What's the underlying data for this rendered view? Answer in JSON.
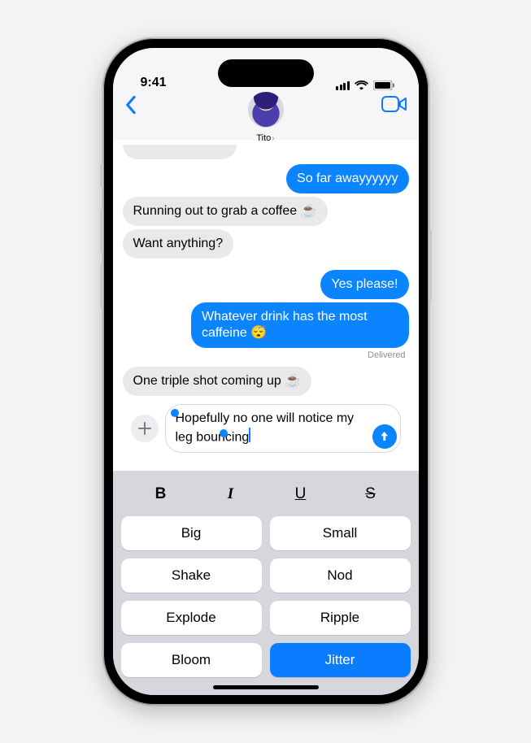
{
  "status": {
    "time": "9:41"
  },
  "header": {
    "contact_name": "Tito"
  },
  "conversation": {
    "m0": "So far awayyyyyy",
    "m1": "Running out to grab a coffee ☕️",
    "m2": "Want anything?",
    "m3": "Yes please!",
    "m4": "Whatever drink has the most caffeine 😴",
    "delivered": "Delivered",
    "m5": "One triple shot coming up ☕️"
  },
  "compose": {
    "text_full": "Hopefully no one will notice my leg bouncing",
    "text_before_caret": "Hopefully no one will notice my leg bouncing",
    "selected_word": "bouncing"
  },
  "format_row": {
    "bold": "B",
    "italic": "I",
    "underline": "U",
    "strike": "S"
  },
  "effects": {
    "big": "Big",
    "small": "Small",
    "shake": "Shake",
    "nod": "Nod",
    "explode": "Explode",
    "ripple": "Ripple",
    "bloom": "Bloom",
    "jitter": "Jitter",
    "active": "jitter"
  }
}
